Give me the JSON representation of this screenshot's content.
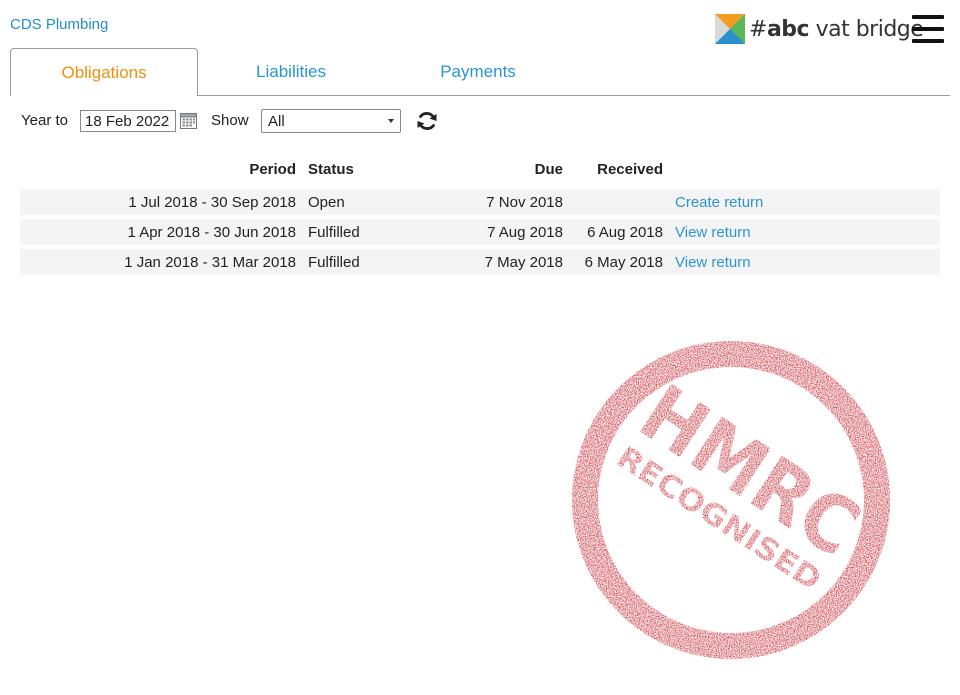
{
  "header": {
    "company_name": "CDS Plumbing",
    "brand": {
      "hash": "#",
      "abc": "abc",
      "rest": " vat bridge"
    },
    "menu_icon": "hamburger-menu-icon"
  },
  "tabs": [
    {
      "label": "Obligations",
      "active": true
    },
    {
      "label": "Liabilities",
      "active": false
    },
    {
      "label": "Payments",
      "active": false
    }
  ],
  "filters": {
    "year_label": "Year to",
    "year_value": "18 Feb 2022",
    "show_label": "Show",
    "show_value": "All",
    "calendar_icon": "calendar-icon",
    "refresh_icon": "refresh-icon"
  },
  "table": {
    "headers": {
      "period": "Period",
      "status": "Status",
      "due": "Due",
      "received": "Received"
    },
    "rows": [
      {
        "period": "1 Jul 2018 - 30 Sep 2018",
        "status": "Open",
        "due": "7 Nov 2018",
        "received": "",
        "action": "Create return"
      },
      {
        "period": "1 Apr 2018 - 30 Jun 2018",
        "status": "Fulfilled",
        "due": "7 Aug 2018",
        "received": "6 Aug 2018",
        "action": "View return"
      },
      {
        "period": "1 Jan 2018 - 31 Mar 2018",
        "status": "Fulfilled",
        "due": "7 May 2018",
        "received": "6 May 2018",
        "action": "View return"
      }
    ]
  },
  "stamp": {
    "line1": "HMRC",
    "line2": "RECOGNISED",
    "color": "#c9202a"
  },
  "colors": {
    "link": "#2a95d4",
    "active_tab": "#f0900c",
    "row_background": "#f4f4f4"
  }
}
